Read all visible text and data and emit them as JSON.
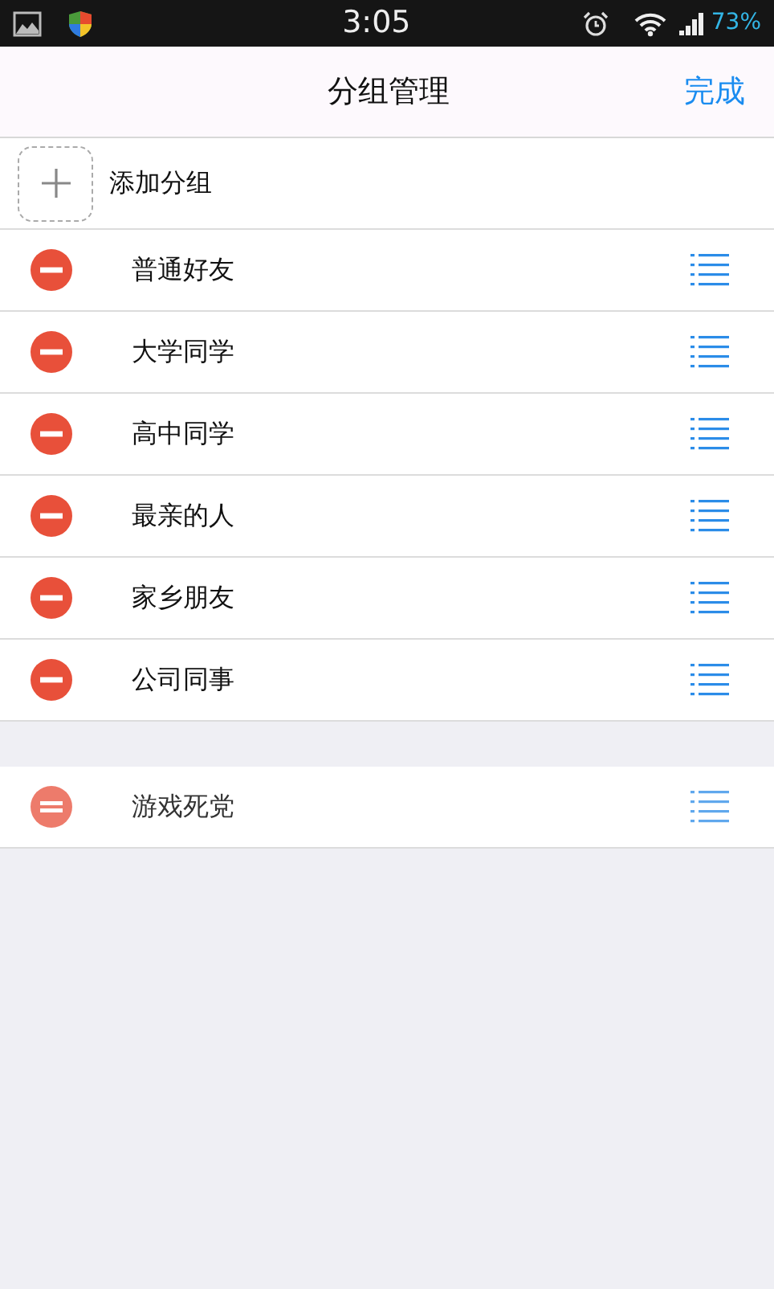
{
  "status_bar": {
    "time": "3:05",
    "battery": "73%"
  },
  "header": {
    "title": "分组管理",
    "done": "完成"
  },
  "add_group": {
    "label": "添加分组"
  },
  "groups": [
    {
      "name": "普通好友"
    },
    {
      "name": "大学同学"
    },
    {
      "name": "高中同学"
    },
    {
      "name": "最亲的人"
    },
    {
      "name": "家乡朋友"
    },
    {
      "name": "公司同事"
    }
  ],
  "dragged_group": {
    "name": "游戏死党",
    "dragging": true
  }
}
